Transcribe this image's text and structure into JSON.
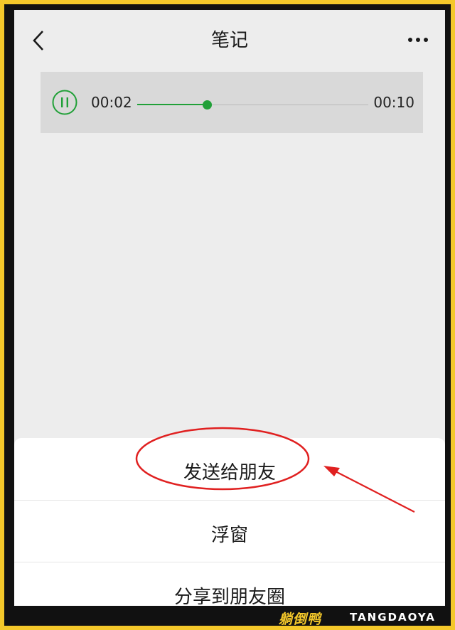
{
  "header": {
    "title": "笔记",
    "back_icon": "chevron-left-icon",
    "more_icon": "more-horizontal-icon"
  },
  "player": {
    "state": "playing",
    "current_time": "00:02",
    "duration": "00:10",
    "progress": 0.3,
    "accent": "#21a038"
  },
  "action_sheet": {
    "options": [
      {
        "label": "发送给朋友"
      },
      {
        "label": "浮窗"
      },
      {
        "label": "分享到朋友圈"
      }
    ]
  },
  "annotation": {
    "color": "#e02020",
    "highlighted_option": "发送给朋友"
  },
  "watermark": {
    "logo_text": "躺倒鸭",
    "brand": "TANGDAOYA"
  }
}
